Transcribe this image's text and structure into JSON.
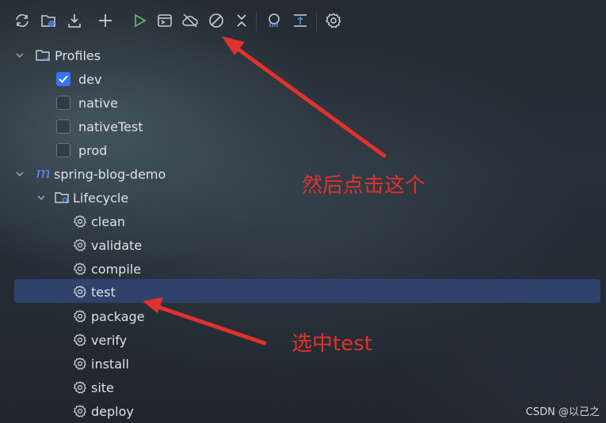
{
  "toolbar": {
    "icons": [
      "reload-icon",
      "add-folder-icon",
      "download-icon",
      "add-icon",
      "run-icon",
      "execute-goal-icon",
      "offline-icon",
      "skip-tests-icon",
      "collapse-icon",
      "analyze-icon",
      "show-dependencies-icon",
      "settings-icon"
    ]
  },
  "tree": {
    "profiles_label": "Profiles",
    "profiles": [
      {
        "label": "dev",
        "checked": true
      },
      {
        "label": "native",
        "checked": false
      },
      {
        "label": "nativeTest",
        "checked": false
      },
      {
        "label": "prod",
        "checked": false
      }
    ],
    "project_label": "spring-blog-demo",
    "lifecycle_label": "Lifecycle",
    "goals": [
      "clean",
      "validate",
      "compile",
      "test",
      "package",
      "verify",
      "install",
      "site",
      "deploy"
    ],
    "selected_goal": "test"
  },
  "annotations": {
    "top": "然后点击这个",
    "bottom": "选中test"
  },
  "watermark": "CSDN @以己之",
  "colors": {
    "selection": "#2e436e",
    "checkbox_on": "#3574f0",
    "annotation": "#e0322d",
    "run_green": "#5fb865"
  }
}
